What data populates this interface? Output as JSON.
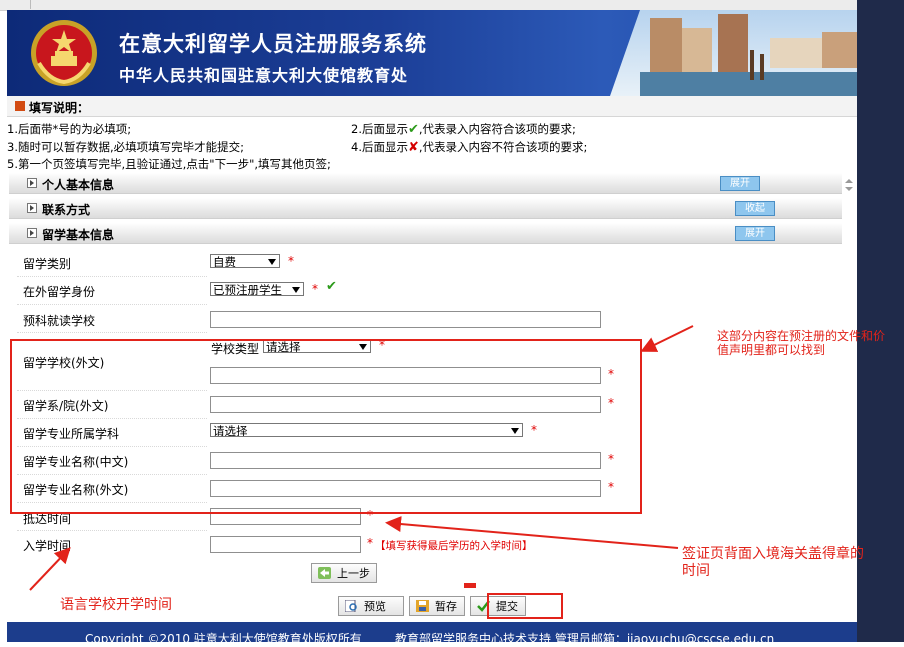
{
  "header": {
    "title": "在意大利留学人员注册服务系统",
    "subtitle": "中华人民共和国驻意大利大使馆教育处"
  },
  "instructions": {
    "heading": "填写说明：",
    "line1": "1.后面带*号的为必填项;",
    "line2_pre": "2.后面显示",
    "line2_post": ",代表录入内容符合该项的要求;",
    "line3": "3.随时可以暂存数据,必填项填写完毕才能提交;",
    "line4_pre": "4.后面显示",
    "line4_post": ",代表录入内容不符合该项的要求;",
    "line5": "5.第一个页签填写完毕,且验证通过,点击\"下一步\",填写其他页签;",
    "ok_mark": "✔",
    "bad_mark": "✘"
  },
  "sections": [
    {
      "title": "个人基本信息",
      "toggle": "展开"
    },
    {
      "title": "联系方式",
      "toggle": "收起"
    },
    {
      "title": "留学基本信息",
      "toggle": "展开"
    }
  ],
  "form": {
    "category_label": "留学类别",
    "category_value": "自费",
    "status_label": "在外留学身份",
    "status_value": "已预注册学生",
    "prep_school_label": "预科就读学校",
    "school_label": "留学学校(外文)",
    "school_type_label": "学校类型",
    "school_type_value": "请选择",
    "department_label": "留学系/院(外文)",
    "discipline_label": "留学专业所属学科",
    "discipline_value": "请选择",
    "major_cn_label": "留学专业名称(中文)",
    "major_foreign_label": "留学专业名称(外文)",
    "arrival_label": "抵达时间",
    "enroll_label": "入学时间",
    "enroll_hint": "【填写获得最后学历的入学时间】",
    "required_mark": "*",
    "valid_mark": "✔"
  },
  "buttons": {
    "prev": "上一步",
    "preview": "预览",
    "save": "暂存",
    "submit": "提交"
  },
  "annotations": {
    "note_right_1": "这部分内容在预注册的文件和价",
    "note_right_2": "值声明里都可以找到",
    "note_visa_1": "签证页背面入境海关盖得章的",
    "note_visa_2": "时间",
    "note_language": "语言学校开学时间"
  },
  "footer": {
    "copyright": "Copyright ©2010 驻意大利大使馆教育处版权所有",
    "support": "教育部留学服务中心技术支持 管理员邮箱：jiaoyuchu@cscse.edu.cn"
  },
  "colors": {
    "header_blue": "#1c3f98",
    "annotation_red": "#e2231a",
    "required_red": "#e00000",
    "valid_green": "#2c9a1a"
  }
}
